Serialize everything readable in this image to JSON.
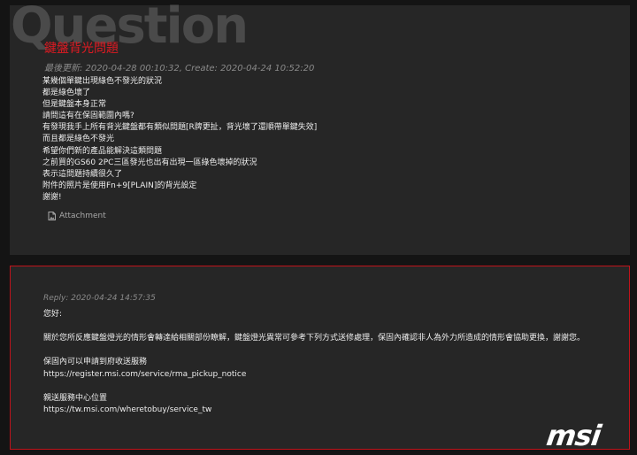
{
  "question": {
    "watermark": "Question",
    "title": "鍵盤背光問題",
    "meta": "最後更新: 2020-04-28 00:10:32, Create: 2020-04-24 10:52:20",
    "body_lines": [
      "某幾個單鍵出現綠色不發光的狀況",
      "都是綠色壞了",
      "但是鍵盤本身正常",
      "請問這有在保固範圍內嗎?",
      "有發現我手上所有背光鍵盤都有類似問題[R牌更扯，背光壞了還順帶單鍵失效]",
      "而且都是綠色不發光",
      "希望你們新的產品能解決這類問題",
      "之前買的GS60 2PC三區發光也出有出現一區綠色壞掉的狀況",
      "表示這問題持續很久了",
      "附件的照片是使用Fn+9[PLAIN]的背光設定",
      "謝謝!"
    ],
    "attachment_label": "Attachment",
    "attachment_icon": "file-image-icon"
  },
  "reply": {
    "meta": "Reply: 2020-04-24 14:57:35",
    "body_lines": [
      "您好:",
      "",
      "關於您所反應鍵盤燈光的情形會轉達給相關部份瞭解，鍵盤燈光異常可參考下列方式送修處理，保固內確認非人為外力所造成的情形會協助更換，謝謝您。",
      "",
      "保固內可以申請到府收送服務",
      "https://register.msi.com/service/rma_pickup_notice",
      "",
      "親送服務中心位置",
      "https://tw.msi.com/wheretobuy/service_tw"
    ]
  },
  "brand": {
    "logo_text": "msi"
  },
  "colors": {
    "background": "#141414",
    "card": "#262626",
    "accent_red": "#e01a22",
    "reply_border": "#c0131b"
  }
}
